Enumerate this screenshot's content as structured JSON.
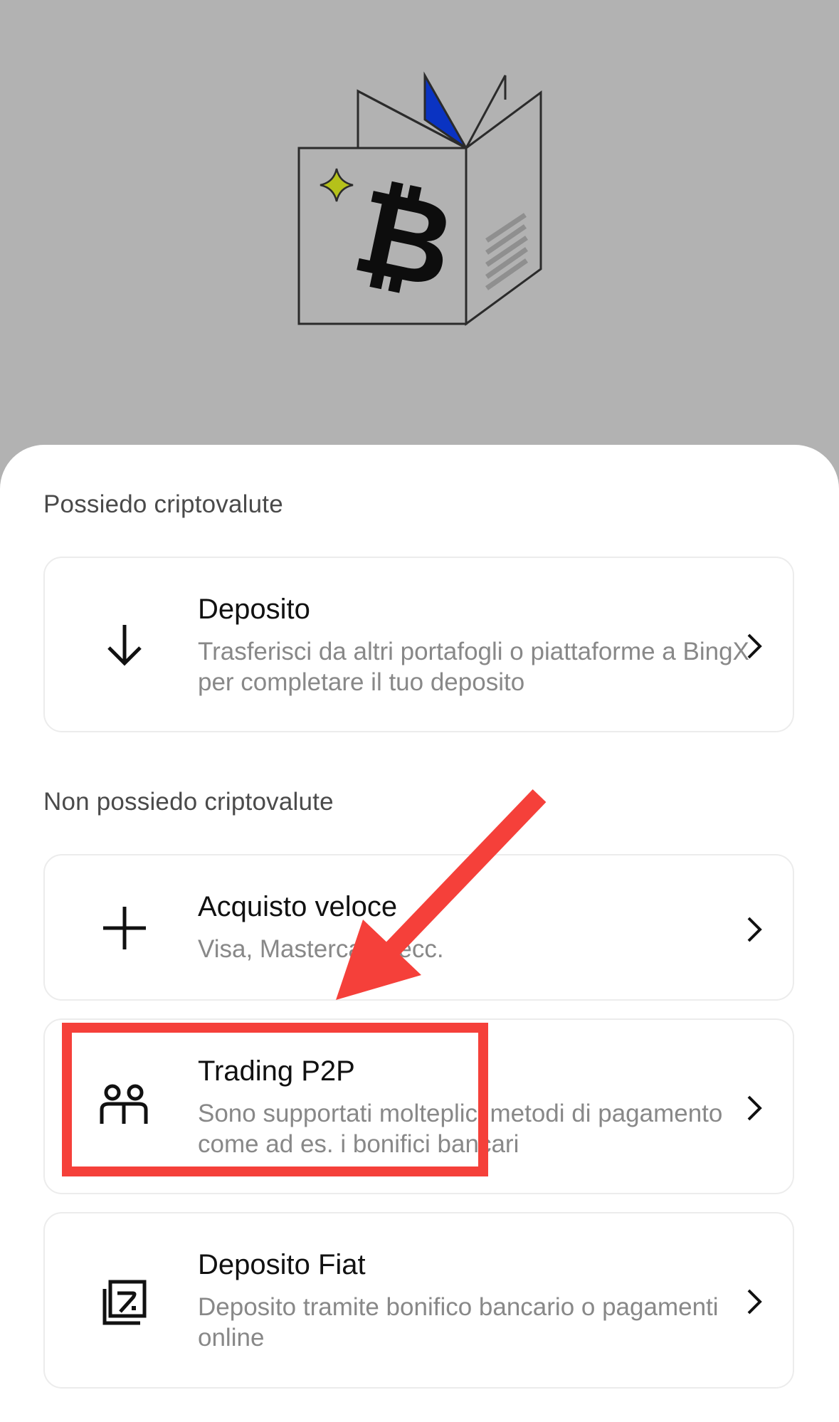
{
  "sections": {
    "have_crypto": "Possiedo criptovalute",
    "no_crypto": "Non possiedo criptovalute"
  },
  "options": [
    {
      "title": "Deposito",
      "description": "Trasferisci da altri portafogli o piattaforme a BingX per completare il tuo deposito",
      "icon": "arrow-down-icon"
    },
    {
      "title": "Acquisto veloce",
      "description": "Visa, Mastercard, ecc.",
      "icon": "plus-icon"
    },
    {
      "title": "Trading P2P",
      "description": "Sono supportati molteplici metodi di pagamento come ad es. i bonifici bancari",
      "icon": "users-icon"
    },
    {
      "title": "Deposito Fiat",
      "description": "Deposito tramite bonifico bancario o pagamenti online",
      "icon": "fiat-icon"
    }
  ],
  "colors": {
    "annotation_red": "#f5403a",
    "illustration_blue": "#0a33c2",
    "illustration_star": "#b5c11a"
  }
}
